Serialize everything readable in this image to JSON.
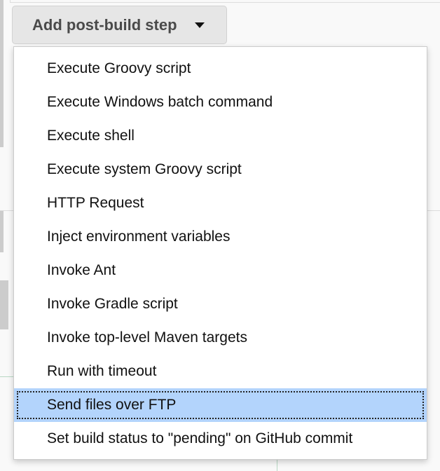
{
  "button": {
    "label": "Add post-build step",
    "icon": "caret-down-icon"
  },
  "menu": {
    "items": [
      {
        "label": "Execute Groovy script"
      },
      {
        "label": "Execute Windows batch command"
      },
      {
        "label": "Execute shell"
      },
      {
        "label": "Execute system Groovy script"
      },
      {
        "label": "HTTP Request"
      },
      {
        "label": "Inject environment variables"
      },
      {
        "label": "Invoke Ant"
      },
      {
        "label": "Invoke Gradle script"
      },
      {
        "label": "Invoke top-level Maven targets"
      },
      {
        "label": "Run with timeout"
      },
      {
        "label": "Send files over FTP",
        "selected": true
      },
      {
        "label": "Set build status to \"pending\" on GitHub commit"
      }
    ],
    "highlight_color": "#b3d4fc"
  }
}
